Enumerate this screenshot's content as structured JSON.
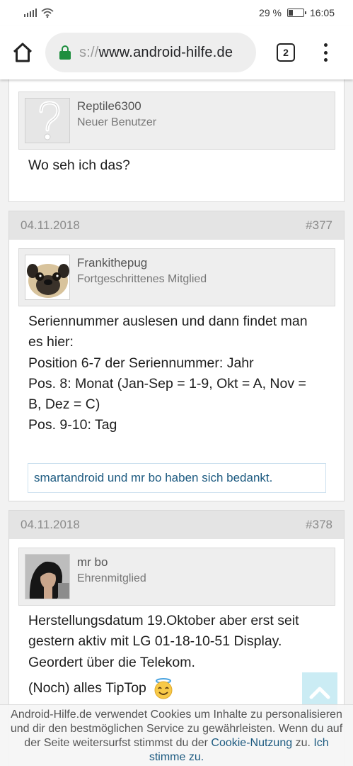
{
  "status_bar": {
    "battery": "29 %",
    "time": "16:05"
  },
  "browser": {
    "url_scheme": "s://",
    "url_host": "www.android-hilfe.de",
    "tab_count": "2",
    "icons": [
      "home-icon",
      "lock-icon",
      "tabs-icon",
      "overflow-menu-icon"
    ],
    "secure_color": "#1e8e3e"
  },
  "posts": [
    {
      "username": "Reptile6300",
      "rank": "Neuer Benutzer",
      "lines": [
        "Wo seh ich das?"
      ]
    },
    {
      "date": "04.11.2018",
      "number": "#377",
      "username": "Frankithepug",
      "rank": "Fortgeschrittenes Mitglied",
      "lines": [
        "Seriennummer auslesen und dann findet man",
        "es hier:",
        "Position 6-7 der Seriennummer: Jahr",
        "Pos. 8: Monat (Jan-Sep = 1-9, Okt = A, Nov =",
        "B, Dez = C)",
        "Pos. 9-10: Tag"
      ],
      "thanks": "smartandroid und mr bo haben sich bedankt."
    },
    {
      "date": "04.11.2018",
      "number": "#378",
      "username": "mr bo",
      "rank": "Ehrenmitglied",
      "lines": [
        "Herstellungsdatum 19.Oktober aber erst seit",
        "gestern aktiv mit LG 01-18-10-51 Display.",
        "Geordert über die Telekom.",
        "(Noch) alles TipTop"
      ]
    }
  ],
  "cookie_notice": {
    "text_line1": "Android-Hilfe.de verwendet Cookies um Inhalte zu personalisieren",
    "text_line2": "und dir den bestmöglichen Service zu gewährleisten. Wenn du auf",
    "text_line3_pre": "der Seite weitersurfst stimmst du der ",
    "link_cookie": "Cookie-Nutzung",
    "text_line3_post": " zu. ",
    "link_accept_1": "Ich",
    "link_accept_2": "stimme zu."
  },
  "colors": {
    "link": "#1c5a80",
    "header_bg": "#e4e4e4",
    "page_bg": "#f2f2f2"
  }
}
